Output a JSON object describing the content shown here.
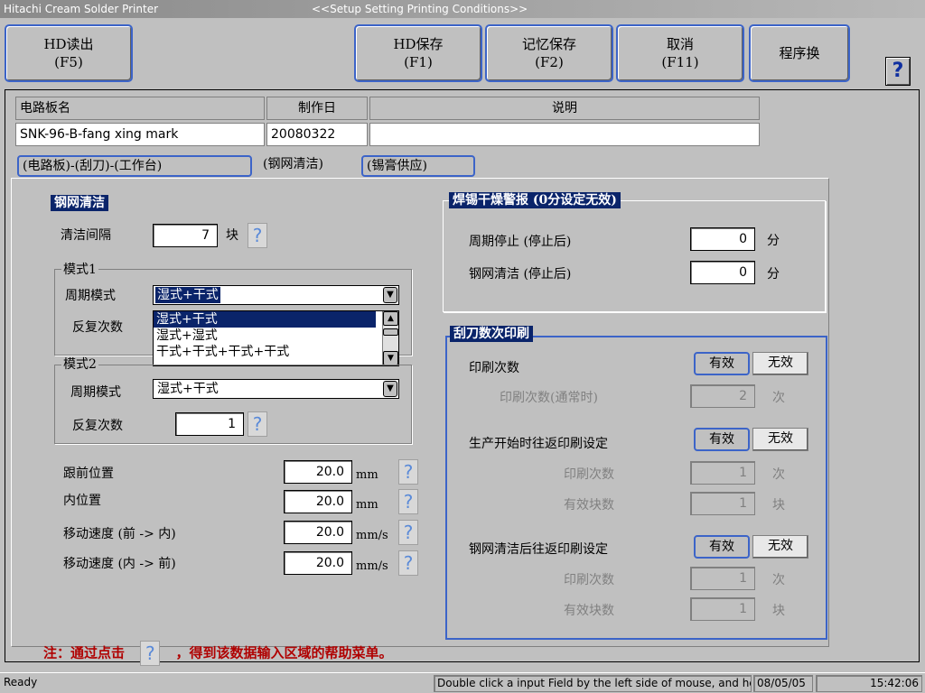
{
  "window": {
    "app_title": "Hitachi Cream Solder Printer",
    "screen_title": "<<Setup Setting Printing Conditions>>"
  },
  "toolbar": {
    "hd_read": {
      "label": "HD读出",
      "key": "(F5)"
    },
    "hd_save": {
      "label": "HD保存",
      "key": "(F1)"
    },
    "mem_save": {
      "label": "记忆保存",
      "key": "(F2)"
    },
    "cancel": {
      "label": "取消",
      "key": "(F11)"
    },
    "program_swap": {
      "label": "程序换"
    },
    "help": "?"
  },
  "header_table": {
    "col_board_name": "电路板名",
    "col_date": "制作日",
    "col_desc": "说明",
    "board_name": "SNK-96-B-fang xing mark",
    "date": "20080322",
    "desc": ""
  },
  "tabs": [
    {
      "label": "(电路板)-(刮刀)-(工作台)",
      "active": false
    },
    {
      "label": "(钢网清洁)",
      "active": true
    },
    {
      "label": "(锡膏供应)",
      "active": false
    }
  ],
  "stencil_clean": {
    "title": "钢网清洁",
    "interval_label": "清洁间隔",
    "interval_value": "7",
    "interval_unit": "块",
    "mode1": {
      "title": "模式1",
      "cycle_label": "周期模式",
      "cycle_value": "湿式+干式",
      "repeat_label": "反复次数",
      "options": [
        "湿式+干式",
        "湿式+湿式",
        "干式+干式+干式+干式"
      ]
    },
    "mode2": {
      "title": "模式2",
      "cycle_label": "周期模式",
      "cycle_value": "湿式+干式",
      "repeat_label": "反复次数",
      "repeat_value": "1"
    },
    "positions": [
      {
        "label": "跟前位置",
        "value": "20.0",
        "unit": "mm"
      },
      {
        "label": "内位置",
        "value": "20.0",
        "unit": "mm"
      },
      {
        "label": "移动速度 (前  -> 内)",
        "value": "20.0",
        "unit": "mm/s"
      },
      {
        "label": "移动速度 (内  -> 前)",
        "value": "20.0",
        "unit": "mm/s"
      }
    ]
  },
  "dry_alarm": {
    "title": "焊锡干燥警报 (0分设定无效)",
    "cycle_stop_label": "周期停止 (停止后)",
    "cycle_stop_value": "0",
    "stencil_clean_label": "钢网清洁 (停止后)",
    "stencil_clean_value": "0",
    "unit": "分"
  },
  "squeegee_print": {
    "title": "刮刀数次印刷",
    "valid": "有效",
    "invalid": "无效",
    "print_count_label": "印刷次数",
    "print_count_normal_label": "印刷次数(通常时)",
    "print_count_normal_value": "2",
    "times_unit": "次",
    "blocks_unit": "块",
    "start_label": "生产开始时往返印刷设定",
    "start_print_count_label": "印刷次数",
    "start_print_count_value": "1",
    "start_valid_blocks_label": "有效块数",
    "start_valid_blocks_value": "1",
    "after_clean_label": "钢网清洁后往返印刷设定",
    "after_print_count_label": "印刷次数",
    "after_print_count_value": "1",
    "after_valid_blocks_label": "有效块数",
    "after_valid_blocks_value": "1"
  },
  "note": {
    "prefix": "注：通过点击",
    "suffix": "，得到该数据输入区域的帮助菜单。"
  },
  "status": {
    "ready": "Ready",
    "hint": "Double click a input Field by the left side of mouse, and help is",
    "date": "08/05/05",
    "time": "15:42:06"
  },
  "colors": {
    "accent_blue": "#3c64c8",
    "selection": "#0a246a",
    "note_red": "#b00000"
  }
}
